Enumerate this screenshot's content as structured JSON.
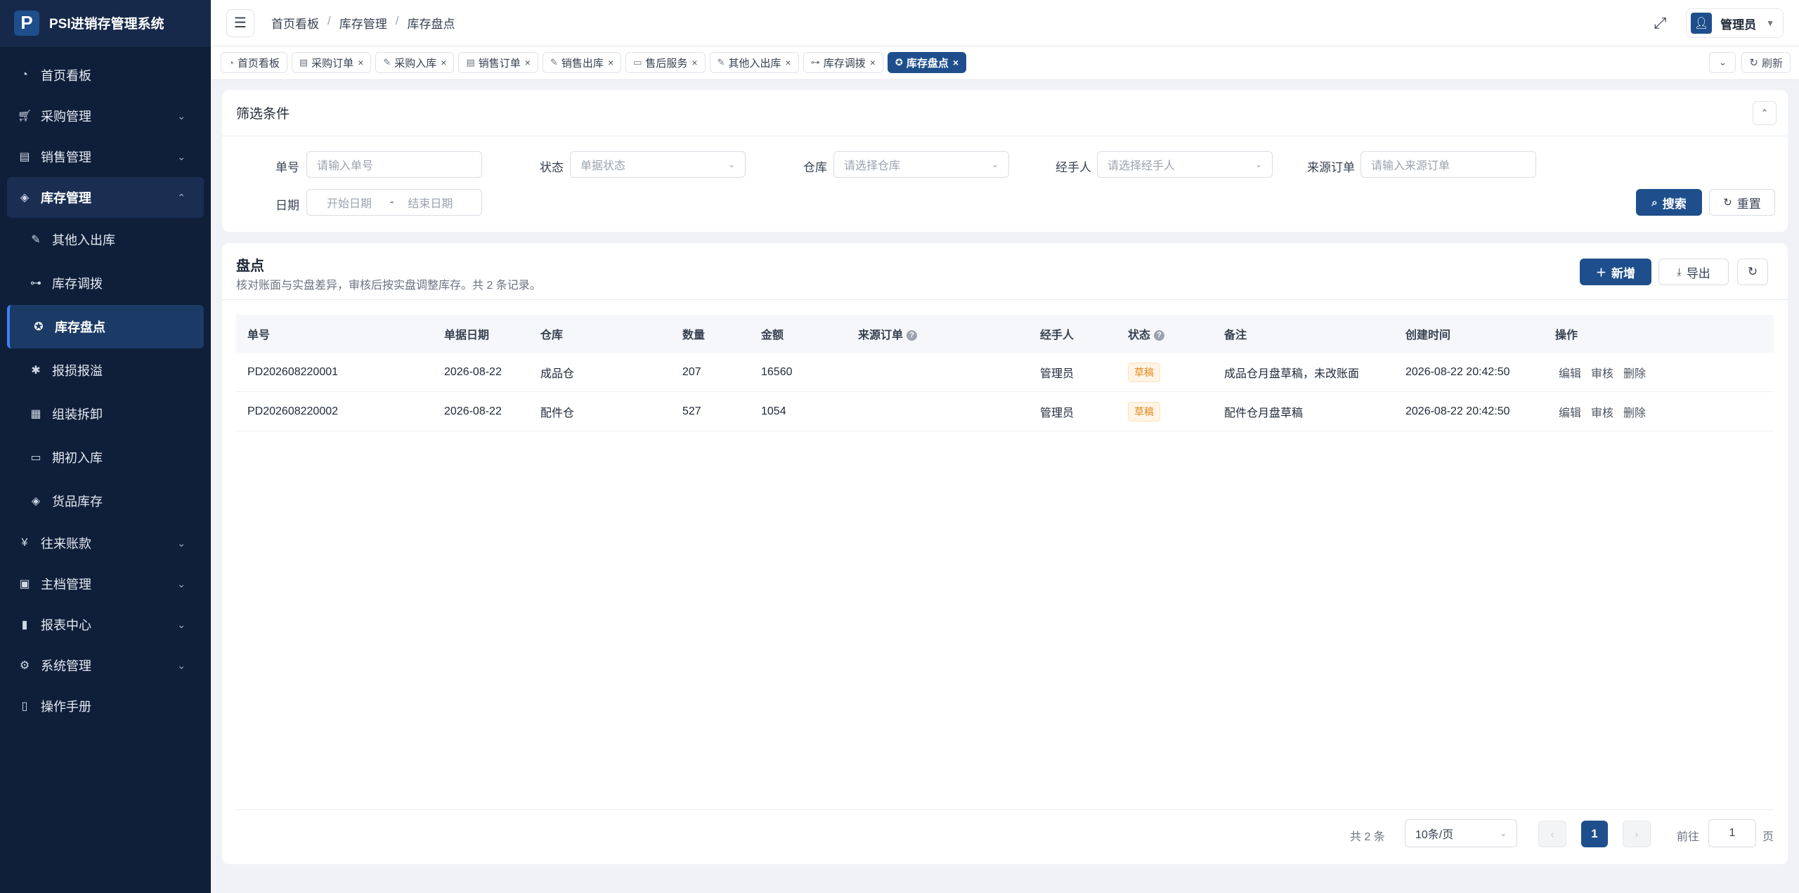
{
  "app": {
    "logo_letter": "P",
    "title": "PSI进销存管理系统"
  },
  "sidebar": {
    "items": [
      {
        "label": "首页看板",
        "icon": "dashboard-icon"
      },
      {
        "label": "采购管理",
        "icon": "cart-icon"
      },
      {
        "label": "销售管理",
        "icon": "sales-icon"
      },
      {
        "label": "库存管理",
        "icon": "layers-icon"
      },
      {
        "label": "往来账款",
        "icon": "yen-icon"
      },
      {
        "label": "主档管理",
        "icon": "archive-icon"
      },
      {
        "label": "报表中心",
        "icon": "bar-chart-icon"
      },
      {
        "label": "系统管理",
        "icon": "gear-icon"
      },
      {
        "label": "操作手册",
        "icon": "book-icon"
      }
    ],
    "inventory_sub": [
      {
        "label": "其他入出库",
        "icon": "edit-icon"
      },
      {
        "label": "库存调拨",
        "icon": "transfer-icon"
      },
      {
        "label": "库存盘点",
        "icon": "check-circle-icon"
      },
      {
        "label": "报损报溢",
        "icon": "bug-icon"
      },
      {
        "label": "组装拆卸",
        "icon": "grid-icon"
      },
      {
        "label": "期初入库",
        "icon": "calendar-icon"
      },
      {
        "label": "货品库存",
        "icon": "stack-icon"
      }
    ]
  },
  "header": {
    "breadcrumb": [
      "首页看板",
      "库存管理",
      "库存盘点"
    ],
    "separator": "/",
    "user_name": "管理员"
  },
  "tabs": [
    {
      "label": "首页看板",
      "closable": false
    },
    {
      "label": "采购订单",
      "closable": true
    },
    {
      "label": "采购入库",
      "closable": true
    },
    {
      "label": "销售订单",
      "closable": true
    },
    {
      "label": "销售出库",
      "closable": true
    },
    {
      "label": "售后服务",
      "closable": true
    },
    {
      "label": "其他入出库",
      "closable": true
    },
    {
      "label": "库存调拨",
      "closable": true
    },
    {
      "label": "库存盘点",
      "closable": true,
      "active": true
    }
  ],
  "tabs_right": {
    "refresh_label": "刷新"
  },
  "filter": {
    "title": "筛选条件",
    "order_no_label": "单号",
    "order_no_placeholder": "请输入单号",
    "status_label": "状态",
    "status_placeholder": "单据状态",
    "warehouse_label": "仓库",
    "warehouse_placeholder": "请选择仓库",
    "handler_label": "经手人",
    "handler_placeholder": "请选择经手人",
    "source_label": "来源订单",
    "source_placeholder": "请输入来源订单",
    "date_label": "日期",
    "date_start_placeholder": "开始日期",
    "date_sep": "-",
    "date_end_placeholder": "结束日期",
    "search_label": "搜索",
    "reset_label": "重置"
  },
  "list": {
    "title": "盘点",
    "subtitle": "核对账面与实盘差异，审核后按实盘调整库存。共 2 条记录。",
    "add_label": "新增",
    "export_label": "导出",
    "columns": [
      "单号",
      "单据日期",
      "仓库",
      "数量",
      "金额",
      "来源订单",
      "经手人",
      "状态",
      "备注",
      "创建时间",
      "操作"
    ],
    "rows": [
      {
        "no": "PD202608220001",
        "date": "2026-08-22",
        "warehouse": "成品仓",
        "qty": "207",
        "amount": "16560",
        "source": "",
        "handler": "管理员",
        "status": "草稿",
        "remark": "成品仓月盘草稿，未改账面",
        "created": "2026-08-22 20:42:50"
      },
      {
        "no": "PD202608220002",
        "date": "2026-08-22",
        "warehouse": "配件仓",
        "qty": "527",
        "amount": "1054",
        "source": "",
        "handler": "管理员",
        "status": "草稿",
        "remark": "配件仓月盘草稿",
        "created": "2026-08-22 20:42:50"
      }
    ],
    "actions": [
      "编辑",
      "审核",
      "删除"
    ]
  },
  "pager": {
    "total": "共 2 条",
    "page_size": "10条/页",
    "current": "1",
    "goto_label": "前往",
    "goto_value": "1",
    "page_suffix": "页"
  },
  "colors": {
    "sidebar_bg": "#0f1f3a",
    "primary": "#1e4f8c",
    "status_draft": "#e08a1e"
  }
}
